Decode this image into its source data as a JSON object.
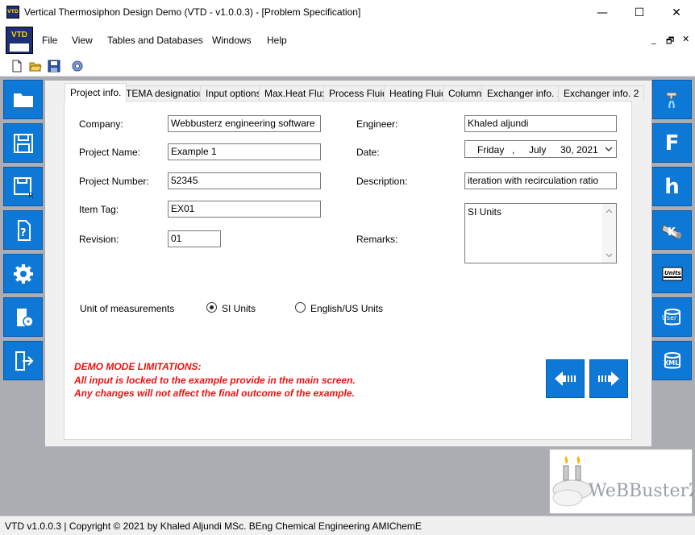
{
  "window": {
    "title": "Vertical Thermosiphon Design Demo (VTD - v1.0.0.3) - [Problem Specification]",
    "app_icon_text": "VTD",
    "minimize": "—",
    "maximize": "☐",
    "close": "✕"
  },
  "menu": {
    "logo_text": "VTD",
    "items": [
      "File",
      "View",
      "Tables and Databases",
      "Windows",
      "Help"
    ],
    "mdi_minimize": "_",
    "mdi_restore": "🗗",
    "mdi_close": "✕"
  },
  "toolbar": {
    "icons": [
      "new-file-icon",
      "open-folder-icon",
      "save-icon",
      "network-settings-icon"
    ]
  },
  "left_sidebar": {
    "icons": [
      "open-folder-icon",
      "save-icon",
      "save-as-icon",
      "help-icon",
      "settings-icon",
      "about-icon",
      "exit-icon"
    ],
    "save_as_letter": "R"
  },
  "right_sidebar": {
    "letters": [
      "F",
      "h",
      "K"
    ],
    "units_label": "Units",
    "user_label": "User",
    "xml_label": "XML"
  },
  "tabs": [
    {
      "label": "Project info.",
      "active": true
    },
    {
      "label": "TEMA designation",
      "active": false
    },
    {
      "label": "Input options",
      "active": false
    },
    {
      "label": "Max.Heat Flux",
      "active": false
    },
    {
      "label": "Process Fluid",
      "active": false
    },
    {
      "label": "Heating Fluid",
      "active": false
    },
    {
      "label": "Column",
      "active": false
    },
    {
      "label": "Exchanger info. 1",
      "active": false
    },
    {
      "label": "Exchanger info. 2",
      "active": false
    }
  ],
  "form": {
    "company_label": "Company:",
    "company_value": "Webbusterz engineering software",
    "project_name_label": "Project Name:",
    "project_name_value": "Example 1",
    "project_number_label": "Project Number:",
    "project_number_value": "52345",
    "item_tag_label": "Item Tag:",
    "item_tag_value": "EX01",
    "revision_label": "Revision:",
    "revision_value": "01",
    "engineer_label": "Engineer:",
    "engineer_value": "Khaled aljundi",
    "date_label": "Date:",
    "date_weekday": "Friday",
    "date_sep": ",",
    "date_month": "July",
    "date_day_year": "30, 2021",
    "description_label": "Description:",
    "description_value": "iteration with recirculation ratio",
    "remarks_label": "Remarks:",
    "remarks_value": "SI Units",
    "units_label": "Unit of measurements",
    "unit_si": "SI Units",
    "unit_us": "English/US Units",
    "unit_selected": "SI Units"
  },
  "demo": {
    "line1": "DEMO MODE LIMITATIONS:",
    "line2": "All input is locked to the example provide in the main screen.",
    "line3": "Any changes will not affect the final outcome of the example."
  },
  "logo": {
    "text": "WeBBusterZ"
  },
  "statusbar": {
    "text": "VTD v1.0.0.3  |  Copyright © 2021 by Khaled Aljundi MSc. BEng Chemical Engineering AMIChemE"
  },
  "colors": {
    "accent": "#0e78d6",
    "demo_red": "#e11111",
    "workspace": "#abadb3"
  }
}
